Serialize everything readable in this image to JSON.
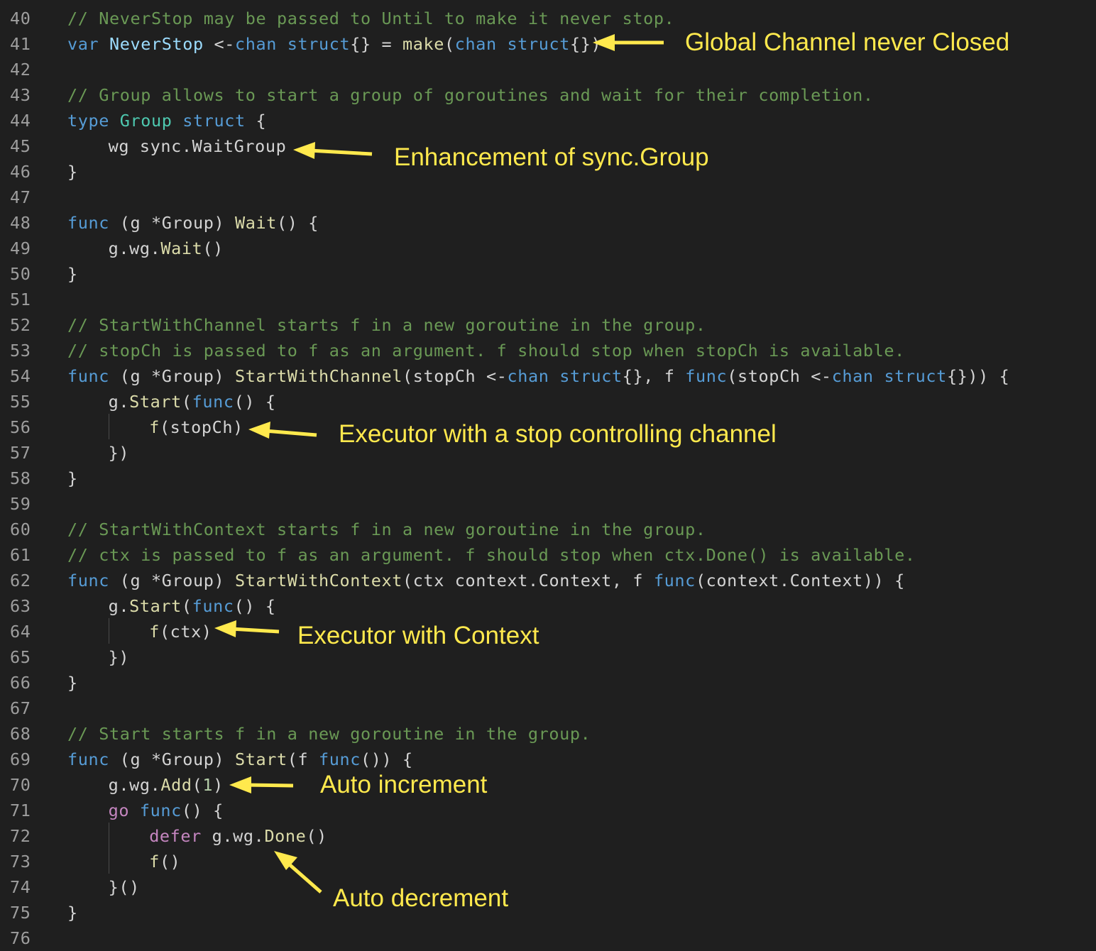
{
  "colors": {
    "background": "#1f1f1f",
    "line_number": "#9e9e9e",
    "comment": "#6a9955",
    "keyword": "#569cd6",
    "type": "#4ec9b0",
    "function": "#dcdcaa",
    "control": "#c586c0",
    "number": "#b5cea8",
    "variable": "#9cdcfe",
    "default": "#d4d4d4",
    "annotation": "#ffe94d"
  },
  "lines": [
    {
      "num": "40",
      "indent": 0,
      "tokens": [
        {
          "t": "// NeverStop may be passed to Until to make it never stop.",
          "c": "comment"
        }
      ]
    },
    {
      "num": "41",
      "indent": 0,
      "tokens": [
        {
          "t": "var ",
          "c": "keyword"
        },
        {
          "t": "NeverStop",
          "c": "variable"
        },
        {
          "t": " <-",
          "c": "default"
        },
        {
          "t": "chan",
          "c": "keyword"
        },
        {
          "t": " ",
          "c": "default"
        },
        {
          "t": "struct",
          "c": "keyword"
        },
        {
          "t": "{} = ",
          "c": "default"
        },
        {
          "t": "make",
          "c": "function"
        },
        {
          "t": "(",
          "c": "default"
        },
        {
          "t": "chan",
          "c": "keyword"
        },
        {
          "t": " ",
          "c": "default"
        },
        {
          "t": "struct",
          "c": "keyword"
        },
        {
          "t": "{})",
          "c": "default"
        }
      ]
    },
    {
      "num": "42",
      "indent": 0,
      "tokens": []
    },
    {
      "num": "43",
      "indent": 0,
      "tokens": [
        {
          "t": "// Group allows to start a group of goroutines and wait for their completion.",
          "c": "comment"
        }
      ]
    },
    {
      "num": "44",
      "indent": 0,
      "tokens": [
        {
          "t": "type ",
          "c": "keyword"
        },
        {
          "t": "Group",
          "c": "type"
        },
        {
          "t": " ",
          "c": "default"
        },
        {
          "t": "struct",
          "c": "keyword"
        },
        {
          "t": " {",
          "c": "default"
        }
      ]
    },
    {
      "num": "45",
      "indent": 1,
      "tokens": [
        {
          "t": "wg sync.WaitGroup",
          "c": "default"
        }
      ]
    },
    {
      "num": "46",
      "indent": 0,
      "tokens": [
        {
          "t": "}",
          "c": "default"
        }
      ]
    },
    {
      "num": "47",
      "indent": 0,
      "tokens": []
    },
    {
      "num": "48",
      "indent": 0,
      "tokens": [
        {
          "t": "func",
          "c": "keyword"
        },
        {
          "t": " (g *Group) ",
          "c": "default"
        },
        {
          "t": "Wait",
          "c": "function"
        },
        {
          "t": "() {",
          "c": "default"
        }
      ]
    },
    {
      "num": "49",
      "indent": 1,
      "tokens": [
        {
          "t": "g.wg.",
          "c": "default"
        },
        {
          "t": "Wait",
          "c": "function"
        },
        {
          "t": "()",
          "c": "default"
        }
      ]
    },
    {
      "num": "50",
      "indent": 0,
      "tokens": [
        {
          "t": "}",
          "c": "default"
        }
      ]
    },
    {
      "num": "51",
      "indent": 0,
      "tokens": []
    },
    {
      "num": "52",
      "indent": 0,
      "tokens": [
        {
          "t": "// StartWithChannel starts f in a new goroutine in the group.",
          "c": "comment"
        }
      ]
    },
    {
      "num": "53",
      "indent": 0,
      "tokens": [
        {
          "t": "// stopCh is passed to f as an argument. f should stop when stopCh is available.",
          "c": "comment"
        }
      ]
    },
    {
      "num": "54",
      "indent": 0,
      "tokens": [
        {
          "t": "func",
          "c": "keyword"
        },
        {
          "t": " (g *Group) ",
          "c": "default"
        },
        {
          "t": "StartWithChannel",
          "c": "function"
        },
        {
          "t": "(stopCh <-",
          "c": "default"
        },
        {
          "t": "chan",
          "c": "keyword"
        },
        {
          "t": " ",
          "c": "default"
        },
        {
          "t": "struct",
          "c": "keyword"
        },
        {
          "t": "{}, f ",
          "c": "default"
        },
        {
          "t": "func",
          "c": "keyword"
        },
        {
          "t": "(stopCh <-",
          "c": "default"
        },
        {
          "t": "chan",
          "c": "keyword"
        },
        {
          "t": " ",
          "c": "default"
        },
        {
          "t": "struct",
          "c": "keyword"
        },
        {
          "t": "{})) {",
          "c": "default"
        }
      ]
    },
    {
      "num": "55",
      "indent": 1,
      "tokens": [
        {
          "t": "g.",
          "c": "default"
        },
        {
          "t": "Start",
          "c": "function"
        },
        {
          "t": "(",
          "c": "default"
        },
        {
          "t": "func",
          "c": "keyword"
        },
        {
          "t": "() {",
          "c": "default"
        }
      ]
    },
    {
      "num": "56",
      "indent": 2,
      "tokens": [
        {
          "t": "f",
          "c": "function"
        },
        {
          "t": "(stopCh)",
          "c": "default"
        }
      ]
    },
    {
      "num": "57",
      "indent": 1,
      "tokens": [
        {
          "t": "})",
          "c": "default"
        }
      ]
    },
    {
      "num": "58",
      "indent": 0,
      "tokens": [
        {
          "t": "}",
          "c": "default"
        }
      ]
    },
    {
      "num": "59",
      "indent": 0,
      "tokens": []
    },
    {
      "num": "60",
      "indent": 0,
      "tokens": [
        {
          "t": "// StartWithContext starts f in a new goroutine in the group.",
          "c": "comment"
        }
      ]
    },
    {
      "num": "61",
      "indent": 0,
      "tokens": [
        {
          "t": "// ctx is passed to f as an argument. f should stop when ctx.Done() is available.",
          "c": "comment"
        }
      ]
    },
    {
      "num": "62",
      "indent": 0,
      "tokens": [
        {
          "t": "func",
          "c": "keyword"
        },
        {
          "t": " (g *Group) ",
          "c": "default"
        },
        {
          "t": "StartWithContext",
          "c": "function"
        },
        {
          "t": "(ctx context.Context, f ",
          "c": "default"
        },
        {
          "t": "func",
          "c": "keyword"
        },
        {
          "t": "(context.Context)) {",
          "c": "default"
        }
      ]
    },
    {
      "num": "63",
      "indent": 1,
      "tokens": [
        {
          "t": "g.",
          "c": "default"
        },
        {
          "t": "Start",
          "c": "function"
        },
        {
          "t": "(",
          "c": "default"
        },
        {
          "t": "func",
          "c": "keyword"
        },
        {
          "t": "() {",
          "c": "default"
        }
      ]
    },
    {
      "num": "64",
      "indent": 2,
      "tokens": [
        {
          "t": "f",
          "c": "function"
        },
        {
          "t": "(ctx)",
          "c": "default"
        }
      ]
    },
    {
      "num": "65",
      "indent": 1,
      "tokens": [
        {
          "t": "})",
          "c": "default"
        }
      ]
    },
    {
      "num": "66",
      "indent": 0,
      "tokens": [
        {
          "t": "}",
          "c": "default"
        }
      ]
    },
    {
      "num": "67",
      "indent": 0,
      "tokens": []
    },
    {
      "num": "68",
      "indent": 0,
      "tokens": [
        {
          "t": "// Start starts f in a new goroutine in the group.",
          "c": "comment"
        }
      ]
    },
    {
      "num": "69",
      "indent": 0,
      "tokens": [
        {
          "t": "func",
          "c": "keyword"
        },
        {
          "t": " (g *Group) ",
          "c": "default"
        },
        {
          "t": "Start",
          "c": "function"
        },
        {
          "t": "(f ",
          "c": "default"
        },
        {
          "t": "func",
          "c": "keyword"
        },
        {
          "t": "()) {",
          "c": "default"
        }
      ]
    },
    {
      "num": "70",
      "indent": 1,
      "tokens": [
        {
          "t": "g.wg.",
          "c": "default"
        },
        {
          "t": "Add",
          "c": "function"
        },
        {
          "t": "(",
          "c": "default"
        },
        {
          "t": "1",
          "c": "number"
        },
        {
          "t": ")",
          "c": "default"
        }
      ]
    },
    {
      "num": "71",
      "indent": 1,
      "tokens": [
        {
          "t": "go",
          "c": "control"
        },
        {
          "t": " ",
          "c": "default"
        },
        {
          "t": "func",
          "c": "keyword"
        },
        {
          "t": "() {",
          "c": "default"
        }
      ]
    },
    {
      "num": "72",
      "indent": 2,
      "tokens": [
        {
          "t": "defer",
          "c": "control"
        },
        {
          "t": " g.wg.",
          "c": "default"
        },
        {
          "t": "Done",
          "c": "function"
        },
        {
          "t": "()",
          "c": "default"
        }
      ]
    },
    {
      "num": "73",
      "indent": 2,
      "tokens": [
        {
          "t": "f",
          "c": "function"
        },
        {
          "t": "()",
          "c": "default"
        }
      ]
    },
    {
      "num": "74",
      "indent": 1,
      "tokens": [
        {
          "t": "}()",
          "c": "default"
        }
      ]
    },
    {
      "num": "75",
      "indent": 0,
      "tokens": [
        {
          "t": "}",
          "c": "default"
        }
      ]
    },
    {
      "num": "76",
      "indent": 0,
      "tokens": []
    }
  ],
  "annotations": [
    {
      "id": "global-channel",
      "text": "Global Channel never Closed"
    },
    {
      "id": "enhancement",
      "text": "Enhancement of sync.Group"
    },
    {
      "id": "executor-stop",
      "text": "Executor with a stop controlling channel"
    },
    {
      "id": "executor-context",
      "text": "Executor with Context"
    },
    {
      "id": "auto-increment",
      "text": "Auto increment"
    },
    {
      "id": "auto-decrement",
      "text": "Auto decrement"
    }
  ]
}
